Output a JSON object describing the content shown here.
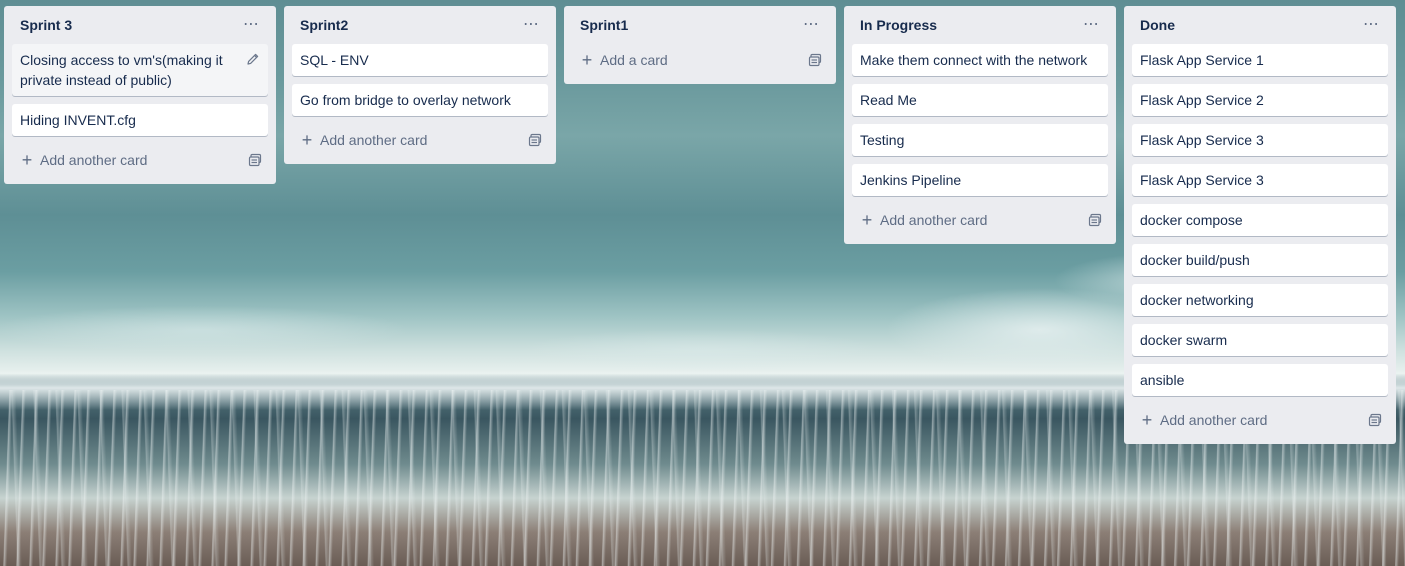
{
  "board": {
    "lists": [
      {
        "title": "Sprint 3",
        "menu": "⋯",
        "cards": [
          "Closing access to vm's(making it private instead of public)",
          "Hiding INVENT.cfg"
        ],
        "add_label": "Add another card"
      },
      {
        "title": "Sprint2",
        "menu": "⋯",
        "cards": [
          "SQL - ENV",
          "Go from bridge to overlay network"
        ],
        "add_label": "Add another card"
      },
      {
        "title": "Sprint1",
        "menu": "⋯",
        "cards": [],
        "add_label": "Add a card"
      },
      {
        "title": "In Progress",
        "menu": "⋯",
        "cards": [
          "Make them connect with the network",
          "Read Me",
          "Testing",
          "Jenkins Pipeline"
        ],
        "add_label": "Add another card"
      },
      {
        "title": "Done",
        "menu": "⋯",
        "cards": [
          "Flask App Service 1",
          "Flask App Service 2",
          "Flask App Service 3",
          "Flask App Service 3",
          "docker compose",
          "docker build/push",
          "docker networking",
          "docker swarm",
          "ansible"
        ],
        "add_label": "Add another card"
      }
    ]
  },
  "icons": {
    "plus": "+",
    "edit": "pencil-icon",
    "template": "card-template-icon"
  }
}
